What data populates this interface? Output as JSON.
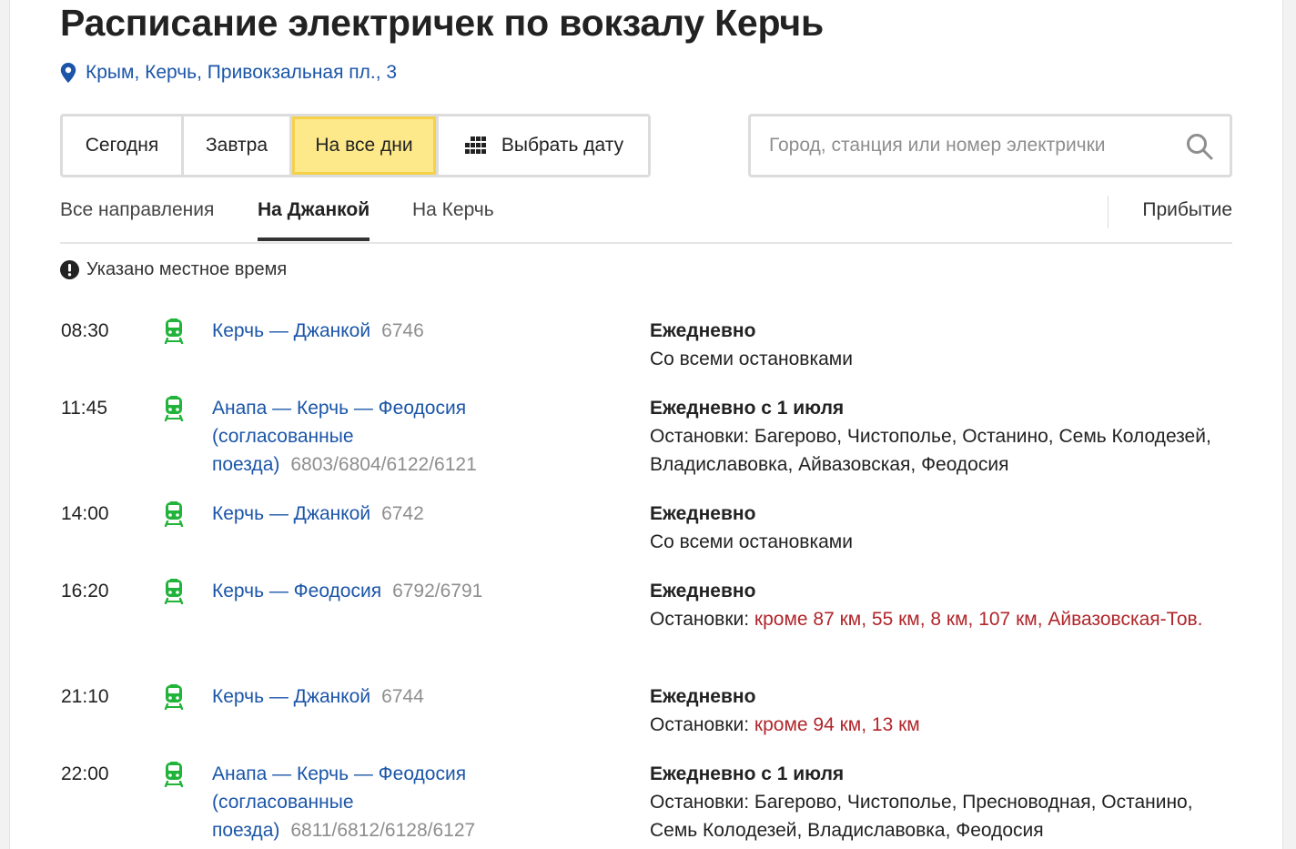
{
  "page": {
    "title": "Расписание электричек по вокзалу Керчь",
    "address": "Крым, Керчь, Привокзальная пл., 3"
  },
  "day_switch": {
    "today": "Сегодня",
    "tomorrow": "Завтра",
    "all_days": "На все дни",
    "pick_date": "Выбрать дату",
    "active": "all_days"
  },
  "search": {
    "placeholder": "Город, станция или номер электрички"
  },
  "tabs": {
    "all": "Все направления",
    "dzhankoy": "На Джанкой",
    "kerch": "На Керчь",
    "arrival": "Прибытие",
    "active": "dzhankoy"
  },
  "notice": "Указано местное время",
  "colors": {
    "accent_link": "#1a55a8",
    "train_green": "#21b33a",
    "active_tab_bg": "#fde98a",
    "exception_red": "#b0262b"
  },
  "trains": [
    {
      "time": "08:30",
      "route": "Керчь — Джанкой",
      "number": "6746",
      "days": "Ежедневно",
      "stops_prefix": "",
      "stops": "Со всеми остановками",
      "stops_except": ""
    },
    {
      "time": "11:45",
      "route": "Анапа — Керчь — Феодосия (согласованные поезда)",
      "number": "6803/6804/6122/6121",
      "days": "Ежедневно с 1 июля",
      "stops_prefix": "",
      "stops": "Остановки: Багерово, Чистополье, Останино, Семь Колодезей, Владиславовка, Айвазовская, Феодосия",
      "stops_except": ""
    },
    {
      "time": "14:00",
      "route": "Керчь — Джанкой",
      "number": "6742",
      "days": "Ежедневно",
      "stops_prefix": "",
      "stops": "Со всеми остановками",
      "stops_except": ""
    },
    {
      "time": "16:20",
      "route": "Керчь — Феодосия",
      "number": "6792/6791",
      "days": "Ежедневно",
      "stops_prefix": "Остановки: ",
      "stops": "",
      "stops_except": "кроме 87 км, 55 км, 8 км, 107 км, Айвазовская-Тов."
    },
    {
      "time": "21:10",
      "route": "Керчь — Джанкой",
      "number": "6744",
      "days": "Ежедневно",
      "stops_prefix": "Остановки: ",
      "stops": "",
      "stops_except": "кроме 94 км, 13 км"
    },
    {
      "time": "22:00",
      "route": "Анапа — Керчь — Феодосия (согласованные поезда)",
      "number": "6811/6812/6128/6127",
      "days": "Ежедневно с 1 июля",
      "stops_prefix": "",
      "stops": "Остановки: Багерово, Чистополье, Пресноводная, Останино, Семь Колодезей, Владиславовка, Феодосия",
      "stops_except": ""
    }
  ]
}
